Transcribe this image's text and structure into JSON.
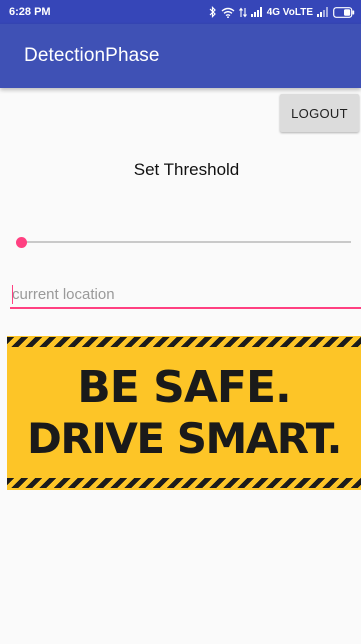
{
  "status_bar": {
    "time": "6:28 PM",
    "network": "4G VoLTE",
    "icons": [
      "bluetooth-icon",
      "wifi-icon",
      "data-arrows-icon",
      "signal-icon",
      "battery-icon"
    ]
  },
  "app_bar": {
    "title": "DetectionPhase",
    "color": "#3f51b5"
  },
  "logout_button": {
    "label": "LOGOUT"
  },
  "threshold": {
    "label": "Set Threshold",
    "slider_value": 0
  },
  "location_input": {
    "value": "",
    "placeholder": "current location"
  },
  "banner": {
    "line1": "BE SAFE.",
    "line2": "DRIVE SMART.",
    "background": "#fdc527"
  },
  "accent_color": "#ff4081"
}
